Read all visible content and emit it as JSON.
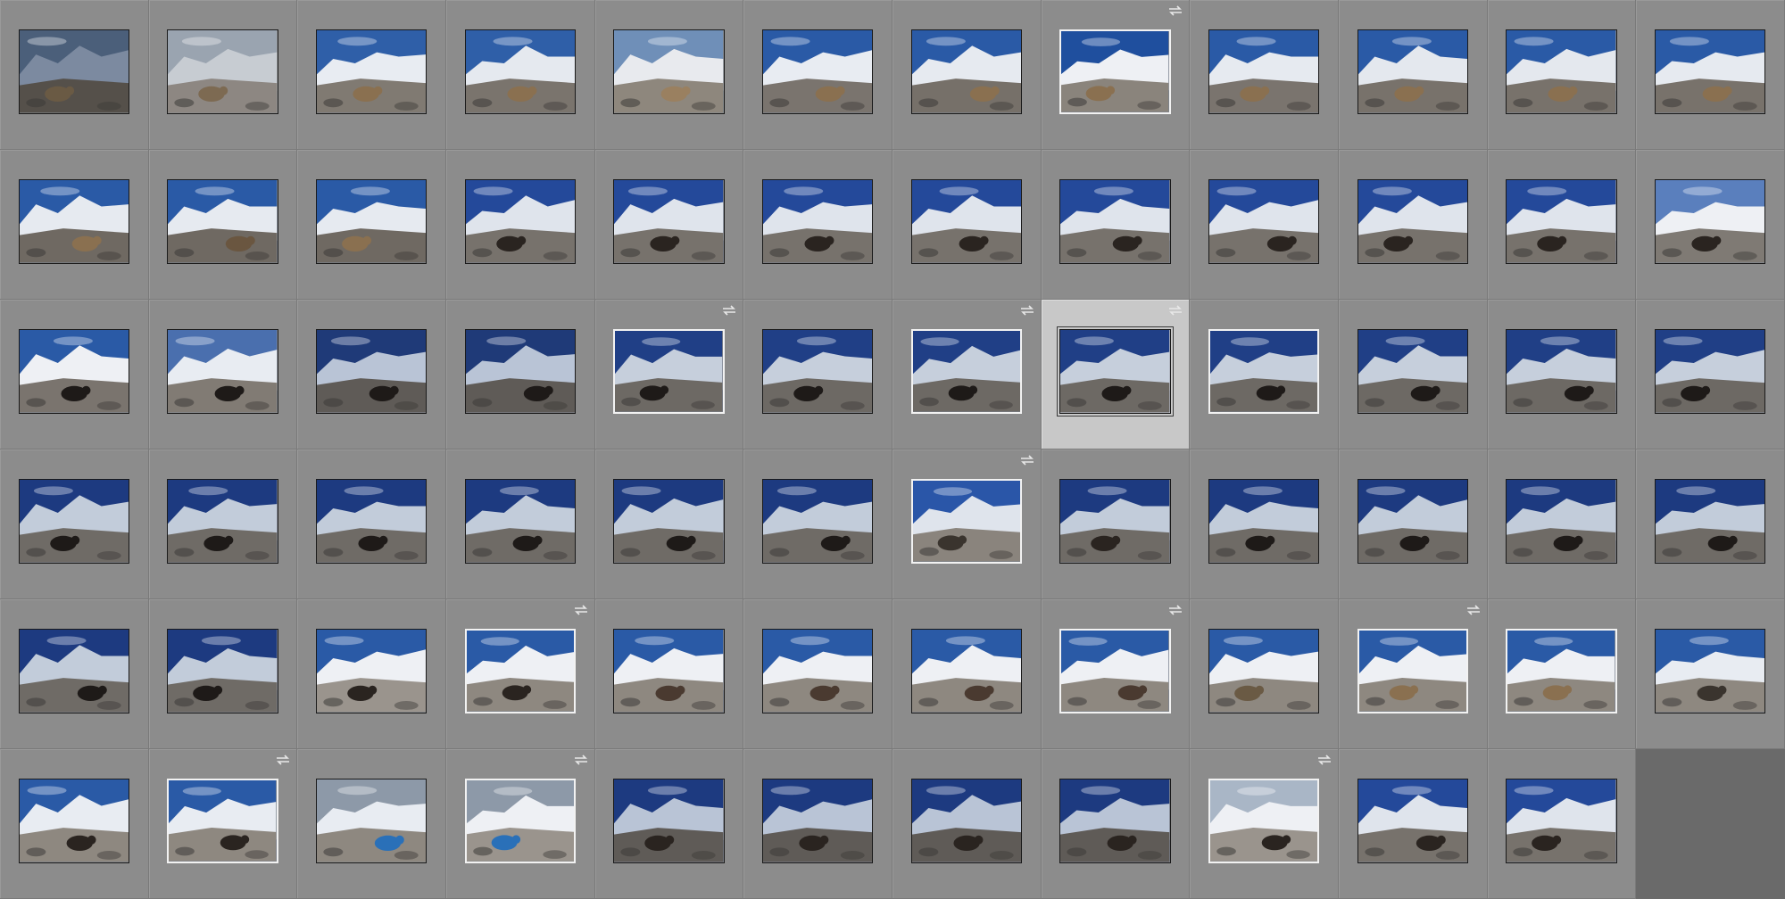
{
  "grid": {
    "columns": 12,
    "rows": 6,
    "empty_cells": 1
  },
  "palette": {
    "cell_bg": "#8c8c8c",
    "cell_selected_bg": "#c8c8c8",
    "workspace_bg": "#6a6a6a",
    "badge_color": "#e8e8e8"
  },
  "icons": {
    "badge": "sync-arrows-icon",
    "thumbnail": "photo-thumbnail"
  },
  "thumbnails": [
    {
      "sky": "#4b5f7a",
      "snow": "#7c8aa0",
      "ground": "#55504a",
      "subject": "#6a5a44",
      "badge": false,
      "highlighted": false,
      "selected": false
    },
    {
      "sky": "#9aa4b0",
      "snow": "#c7ccd2",
      "ground": "#8d8782",
      "subject": "#7d6a52",
      "badge": false,
      "highlighted": false,
      "selected": false
    },
    {
      "sky": "#2f5fa8",
      "snow": "#e8ecf2",
      "ground": "#807a72",
      "subject": "#8a7050",
      "badge": false,
      "highlighted": false,
      "selected": false
    },
    {
      "sky": "#2f5fa8",
      "snow": "#e5e9ef",
      "ground": "#7a746d",
      "subject": "#8a7050",
      "badge": false,
      "highlighted": false,
      "selected": false
    },
    {
      "sky": "#6f8fb8",
      "snow": "#e8eaee",
      "ground": "#8e877d",
      "subject": "#9a8060",
      "badge": false,
      "highlighted": false,
      "selected": false
    },
    {
      "sky": "#2a5aa6",
      "snow": "#e8ecf2",
      "ground": "#7a746e",
      "subject": "#8a7050",
      "badge": false,
      "highlighted": false,
      "selected": false
    },
    {
      "sky": "#2a5aa6",
      "snow": "#e6eaf0",
      "ground": "#767069",
      "subject": "#8a7050",
      "badge": false,
      "highlighted": false,
      "selected": false
    },
    {
      "sky": "#1f4f9e",
      "snow": "#eef0f4",
      "ground": "#8a847c",
      "subject": "#8a7050",
      "badge": true,
      "highlighted": true,
      "selected": false
    },
    {
      "sky": "#2a5aa6",
      "snow": "#e6eaf0",
      "ground": "#7a746e",
      "subject": "#8a7050",
      "badge": false,
      "highlighted": false,
      "selected": false
    },
    {
      "sky": "#2a5aa6",
      "snow": "#e4e8ee",
      "ground": "#78726b",
      "subject": "#8a7050",
      "badge": false,
      "highlighted": false,
      "selected": false
    },
    {
      "sky": "#2a5aa6",
      "snow": "#e4e8ee",
      "ground": "#78726b",
      "subject": "#8a7050",
      "badge": false,
      "highlighted": false,
      "selected": false
    },
    {
      "sky": "#2a5aa6",
      "snow": "#e6eaf0",
      "ground": "#78726b",
      "subject": "#8a7050",
      "badge": false,
      "highlighted": false,
      "selected": false
    },
    {
      "sky": "#2a5aa6",
      "snow": "#e6eaf0",
      "ground": "#6f6962",
      "subject": "#8a7050",
      "badge": false,
      "highlighted": false,
      "selected": false
    },
    {
      "sky": "#2a5aa6",
      "snow": "#e6eaf0",
      "ground": "#6f6962",
      "subject": "#6a5640",
      "badge": false,
      "highlighted": false,
      "selected": false
    },
    {
      "sky": "#2a5aa6",
      "snow": "#e6eaf0",
      "ground": "#6f6962",
      "subject": "#8a7050",
      "badge": false,
      "highlighted": false,
      "selected": false
    },
    {
      "sky": "#24499a",
      "snow": "#dfe4ec",
      "ground": "#77726c",
      "subject": "#2a2420",
      "badge": false,
      "highlighted": false,
      "selected": false
    },
    {
      "sky": "#24499a",
      "snow": "#dfe4ec",
      "ground": "#77726c",
      "subject": "#2a2420",
      "badge": false,
      "highlighted": false,
      "selected": false
    },
    {
      "sky": "#24499a",
      "snow": "#dfe4ec",
      "ground": "#77726c",
      "subject": "#2a2420",
      "badge": false,
      "highlighted": false,
      "selected": false
    },
    {
      "sky": "#24499a",
      "snow": "#dfe4ec",
      "ground": "#77726c",
      "subject": "#2a2420",
      "badge": false,
      "highlighted": false,
      "selected": false
    },
    {
      "sky": "#24499a",
      "snow": "#dfe4ec",
      "ground": "#77726c",
      "subject": "#2a2420",
      "badge": false,
      "highlighted": false,
      "selected": false
    },
    {
      "sky": "#24499a",
      "snow": "#dfe4ec",
      "ground": "#77726c",
      "subject": "#2a2420",
      "badge": false,
      "highlighted": false,
      "selected": false
    },
    {
      "sky": "#24499a",
      "snow": "#dfe4ec",
      "ground": "#77726c",
      "subject": "#2a2420",
      "badge": false,
      "highlighted": false,
      "selected": false
    },
    {
      "sky": "#24499a",
      "snow": "#dfe4ec",
      "ground": "#77726c",
      "subject": "#2a2420",
      "badge": false,
      "highlighted": false,
      "selected": false
    },
    {
      "sky": "#5a7fbd",
      "snow": "#eef0f4",
      "ground": "#7f7a74",
      "subject": "#2a2420",
      "badge": false,
      "highlighted": false,
      "selected": false
    },
    {
      "sky": "#2a5aa6",
      "snow": "#eef0f4",
      "ground": "#7a746e",
      "subject": "#1e1a18",
      "badge": false,
      "highlighted": false,
      "selected": false
    },
    {
      "sky": "#4a6fae",
      "snow": "#e8ecf2",
      "ground": "#817b74",
      "subject": "#1e1a18",
      "badge": false,
      "highlighted": false,
      "selected": false
    },
    {
      "sky": "#1f3a78",
      "snow": "#b9c4d6",
      "ground": "#5f5b57",
      "subject": "#1e1a18",
      "badge": false,
      "highlighted": false,
      "selected": false
    },
    {
      "sky": "#1f3a78",
      "snow": "#b9c4d6",
      "ground": "#5f5b57",
      "subject": "#1e1a18",
      "badge": false,
      "highlighted": false,
      "selected": false
    },
    {
      "sky": "#203f86",
      "snow": "#c6cfdc",
      "ground": "#6d6964",
      "subject": "#1e1a18",
      "badge": true,
      "highlighted": true,
      "selected": false
    },
    {
      "sky": "#203f86",
      "snow": "#c6cfdc",
      "ground": "#6d6964",
      "subject": "#1e1a18",
      "badge": false,
      "highlighted": false,
      "selected": false
    },
    {
      "sky": "#203f86",
      "snow": "#c6cfdc",
      "ground": "#6d6964",
      "subject": "#1e1a18",
      "badge": true,
      "highlighted": true,
      "selected": false
    },
    {
      "sky": "#203f86",
      "snow": "#c6cfdc",
      "ground": "#6d6964",
      "subject": "#1e1a18",
      "badge": true,
      "highlighted": false,
      "selected": true
    },
    {
      "sky": "#203f86",
      "snow": "#c6cfdc",
      "ground": "#6d6964",
      "subject": "#1e1a18",
      "badge": false,
      "highlighted": true,
      "selected": false
    },
    {
      "sky": "#203f86",
      "snow": "#c6cfdc",
      "ground": "#6d6964",
      "subject": "#1e1a18",
      "badge": false,
      "highlighted": false,
      "selected": false
    },
    {
      "sky": "#203f86",
      "snow": "#c6cfdc",
      "ground": "#6d6964",
      "subject": "#1e1a18",
      "badge": false,
      "highlighted": false,
      "selected": false
    },
    {
      "sky": "#203f86",
      "snow": "#c6cfdc",
      "ground": "#6d6964",
      "subject": "#1e1a18",
      "badge": false,
      "highlighted": false,
      "selected": false
    },
    {
      "sky": "#1d3a80",
      "snow": "#c2ccda",
      "ground": "#6f6b66",
      "subject": "#1e1a18",
      "badge": false,
      "highlighted": false,
      "selected": false
    },
    {
      "sky": "#1d3a80",
      "snow": "#c2ccda",
      "ground": "#6f6b66",
      "subject": "#1e1a18",
      "badge": false,
      "highlighted": false,
      "selected": false
    },
    {
      "sky": "#1d3a80",
      "snow": "#c2ccda",
      "ground": "#6f6b66",
      "subject": "#1e1a18",
      "badge": false,
      "highlighted": false,
      "selected": false
    },
    {
      "sky": "#1d3a80",
      "snow": "#c2ccda",
      "ground": "#6f6b66",
      "subject": "#1e1a18",
      "badge": false,
      "highlighted": false,
      "selected": false
    },
    {
      "sky": "#1d3a80",
      "snow": "#c2ccda",
      "ground": "#6f6b66",
      "subject": "#1e1a18",
      "badge": false,
      "highlighted": false,
      "selected": false
    },
    {
      "sky": "#1d3a80",
      "snow": "#c2ccda",
      "ground": "#6f6b66",
      "subject": "#1e1a18",
      "badge": false,
      "highlighted": false,
      "selected": false
    },
    {
      "sky": "#2a56a8",
      "snow": "#dfe4ec",
      "ground": "#8a847d",
      "subject": "#3a342e",
      "badge": true,
      "highlighted": true,
      "selected": false
    },
    {
      "sky": "#1d3a80",
      "snow": "#c2ccda",
      "ground": "#6f6b66",
      "subject": "#2a2420",
      "badge": false,
      "highlighted": false,
      "selected": false
    },
    {
      "sky": "#1d3a80",
      "snow": "#c2ccda",
      "ground": "#6f6b66",
      "subject": "#1e1a18",
      "badge": false,
      "highlighted": false,
      "selected": false
    },
    {
      "sky": "#1d3a80",
      "snow": "#c2ccda",
      "ground": "#6f6b66",
      "subject": "#1e1a18",
      "badge": false,
      "highlighted": false,
      "selected": false
    },
    {
      "sky": "#1d3a80",
      "snow": "#c2ccda",
      "ground": "#6f6b66",
      "subject": "#1e1a18",
      "badge": false,
      "highlighted": false,
      "selected": false
    },
    {
      "sky": "#1d3a80",
      "snow": "#c2ccda",
      "ground": "#6f6b66",
      "subject": "#1e1a18",
      "badge": false,
      "highlighted": false,
      "selected": false
    },
    {
      "sky": "#1d3a80",
      "snow": "#c2ccda",
      "ground": "#6f6b66",
      "subject": "#1e1a18",
      "badge": false,
      "highlighted": false,
      "selected": false
    },
    {
      "sky": "#1d3a80",
      "snow": "#c2ccda",
      "ground": "#6f6b66",
      "subject": "#1e1a18",
      "badge": false,
      "highlighted": false,
      "selected": false
    },
    {
      "sky": "#2a5aa6",
      "snow": "#eef0f4",
      "ground": "#9a948d",
      "subject": "#2a2420",
      "badge": false,
      "highlighted": false,
      "selected": false
    },
    {
      "sky": "#2a5aa6",
      "snow": "#eef0f4",
      "ground": "#8e8880",
      "subject": "#2a2420",
      "badge": true,
      "highlighted": true,
      "selected": false
    },
    {
      "sky": "#2a5aa6",
      "snow": "#eef0f4",
      "ground": "#8e8880",
      "subject": "#4a3a30",
      "badge": false,
      "highlighted": false,
      "selected": false
    },
    {
      "sky": "#2a5aa6",
      "snow": "#eef0f4",
      "ground": "#8e8880",
      "subject": "#4a3a30",
      "badge": false,
      "highlighted": false,
      "selected": false
    },
    {
      "sky": "#2a5aa6",
      "snow": "#eef0f4",
      "ground": "#8e8880",
      "subject": "#4a3a30",
      "badge": false,
      "highlighted": false,
      "selected": false
    },
    {
      "sky": "#2a5aa6",
      "snow": "#eef0f4",
      "ground": "#8e8880",
      "subject": "#4a3a30",
      "badge": true,
      "highlighted": true,
      "selected": false
    },
    {
      "sky": "#2a5aa6",
      "snow": "#eef0f4",
      "ground": "#8e8880",
      "subject": "#6a5a44",
      "badge": false,
      "highlighted": false,
      "selected": false
    },
    {
      "sky": "#2a5aa6",
      "snow": "#eef0f4",
      "ground": "#8e8880",
      "subject": "#8a7050",
      "badge": true,
      "highlighted": true,
      "selected": false
    },
    {
      "sky": "#2a5aa6",
      "snow": "#eef0f4",
      "ground": "#8e8880",
      "subject": "#8a7050",
      "badge": false,
      "highlighted": true,
      "selected": false
    },
    {
      "sky": "#2a5aa6",
      "snow": "#e8ecf2",
      "ground": "#8e8880",
      "subject": "#3a342e",
      "badge": false,
      "highlighted": false,
      "selected": false
    },
    {
      "sky": "#2a5aa6",
      "snow": "#e8ecf2",
      "ground": "#8e8880",
      "subject": "#2a2420",
      "badge": false,
      "highlighted": false,
      "selected": false
    },
    {
      "sky": "#2a5aa6",
      "snow": "#e8ecf2",
      "ground": "#8e8880",
      "subject": "#2a2420",
      "badge": true,
      "highlighted": true,
      "selected": false
    },
    {
      "sky": "#8d99a8",
      "snow": "#e8ecf2",
      "ground": "#8e8880",
      "subject": "#2a70b8",
      "badge": false,
      "highlighted": false,
      "selected": false
    },
    {
      "sky": "#8d99a8",
      "snow": "#eef0f4",
      "ground": "#9a948d",
      "subject": "#2a70b8",
      "badge": true,
      "highlighted": true,
      "selected": false
    },
    {
      "sky": "#1d3a80",
      "snow": "#b9c4d6",
      "ground": "#5f5b57",
      "subject": "#2a2420",
      "badge": false,
      "highlighted": false,
      "selected": false
    },
    {
      "sky": "#1d3a80",
      "snow": "#b9c4d6",
      "ground": "#5f5b57",
      "subject": "#2a2420",
      "badge": false,
      "highlighted": false,
      "selected": false
    },
    {
      "sky": "#1d3a80",
      "snow": "#b9c4d6",
      "ground": "#5f5b57",
      "subject": "#2a2420",
      "badge": false,
      "highlighted": false,
      "selected": false
    },
    {
      "sky": "#1d3a80",
      "snow": "#b9c4d6",
      "ground": "#5f5b57",
      "subject": "#2a2420",
      "badge": false,
      "highlighted": false,
      "selected": false
    },
    {
      "sky": "#a9b6c6",
      "snow": "#eef0f4",
      "ground": "#9a948d",
      "subject": "#2a2420",
      "badge": true,
      "highlighted": true,
      "selected": false
    },
    {
      "sky": "#24499a",
      "snow": "#dfe4ec",
      "ground": "#77726c",
      "subject": "#2a2420",
      "badge": false,
      "highlighted": false,
      "selected": false
    },
    {
      "sky": "#24499a",
      "snow": "#dfe4ec",
      "ground": "#77726c",
      "subject": "#2a2420",
      "badge": false,
      "highlighted": false,
      "selected": false
    }
  ]
}
